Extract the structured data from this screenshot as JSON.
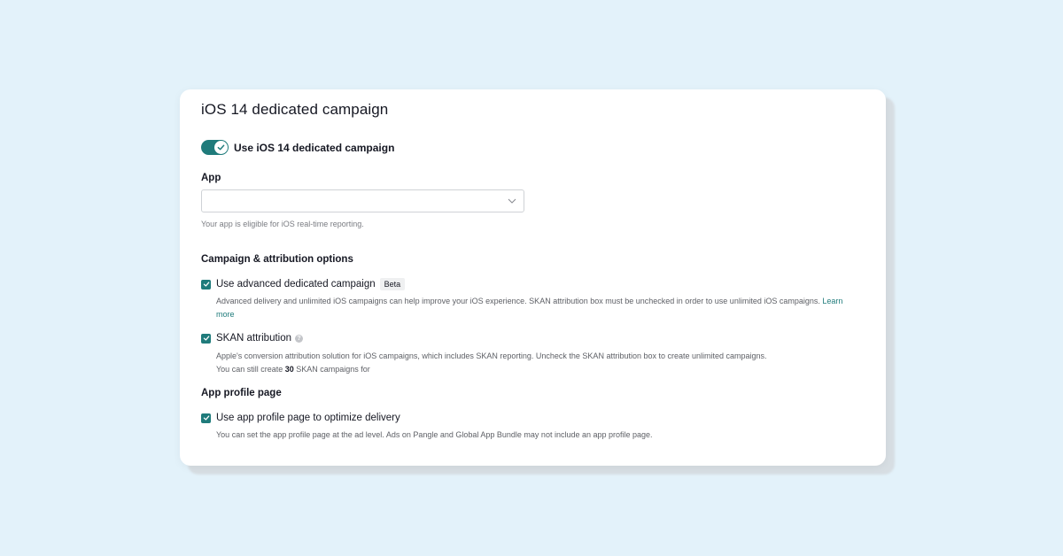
{
  "card": {
    "title": "iOS 14 dedicated campaign",
    "toggle": {
      "label": "Use iOS 14 dedicated campaign",
      "on": true
    },
    "app": {
      "label": "App",
      "value": "",
      "helper": "Your app is eligible for iOS real-time reporting."
    },
    "campaign_options": {
      "heading": "Campaign & attribution options",
      "advanced": {
        "label": "Use advanced dedicated campaign",
        "badge": "Beta",
        "checked": true,
        "desc": "Advanced delivery and unlimited iOS campaigns can help improve your iOS experience. SKAN attribution box must be unchecked in order to use unlimited iOS campaigns. ",
        "link_part1": "Learn",
        "link_part2": "more"
      },
      "skan": {
        "label": "SKAN attribution",
        "help": "?",
        "checked": true,
        "desc": "Apple's conversion attribution solution for iOS campaigns, which includes SKAN reporting. Uncheck the SKAN attribution box to create unlimited campaigns.",
        "remaining_prefix": "You can still create",
        "remaining_count": "30",
        "remaining_suffix": "SKAN campaigns for"
      }
    },
    "profile": {
      "heading": "App profile page",
      "option": {
        "label": "Use app profile page to optimize delivery",
        "checked": true,
        "desc": "You can set the app profile page at the ad level. Ads on Pangle and Global App Bundle may not include an app profile page."
      }
    }
  },
  "colors": {
    "background": "#e3f2fa",
    "accent": "#1f7b7b",
    "card": "#ffffff"
  }
}
